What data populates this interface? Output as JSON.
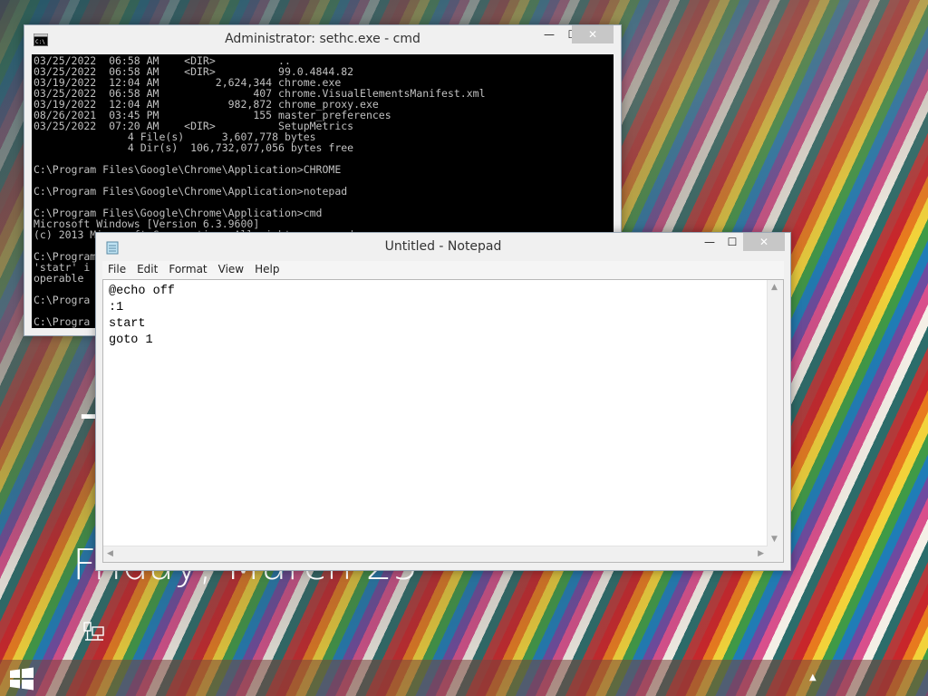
{
  "lockscreen": {
    "time": "7",
    "date": "Friday, March 25"
  },
  "cmd_window": {
    "title": "Administrator: sethc.exe - cmd",
    "icon": "cmd-icon",
    "console_lines": [
      "03/25/2022  06:58 AM    <DIR>          ..",
      "03/25/2022  06:58 AM    <DIR>          99.0.4844.82",
      "03/19/2022  12:04 AM         2,624,344 chrome.exe",
      "03/25/2022  06:58 AM               407 chrome.VisualElementsManifest.xml",
      "03/19/2022  12:04 AM           982,872 chrome_proxy.exe",
      "08/26/2021  03:45 PM               155 master_preferences",
      "03/25/2022  07:20 AM    <DIR>          SetupMetrics",
      "               4 File(s)      3,607,778 bytes",
      "               4 Dir(s)  106,732,077,056 bytes free",
      "",
      "C:\\Program Files\\Google\\Chrome\\Application>CHROME",
      "",
      "C:\\Program Files\\Google\\Chrome\\Application>notepad",
      "",
      "C:\\Program Files\\Google\\Chrome\\Application>cmd",
      "Microsoft Windows [Version 6.3.9600]",
      "(c) 2013 Microsoft Corporation. All rights reserved.",
      "",
      "C:\\Program",
      "'statr' i",
      "operable",
      "",
      "C:\\Progra",
      "",
      "C:\\Progra"
    ]
  },
  "notepad_window": {
    "title": "Untitled - Notepad",
    "icon": "notepad-icon",
    "menu": [
      "File",
      "Edit",
      "Format",
      "View",
      "Help"
    ],
    "content": "@echo off\n:1\nstart\ngoto 1"
  },
  "window_controls": {
    "minimize": "—",
    "maximize": "☐",
    "close": "✕"
  },
  "colors": {
    "console_bg": "#000000",
    "console_fg": "#c0c0c0",
    "close_button": "#c7c7c7"
  }
}
